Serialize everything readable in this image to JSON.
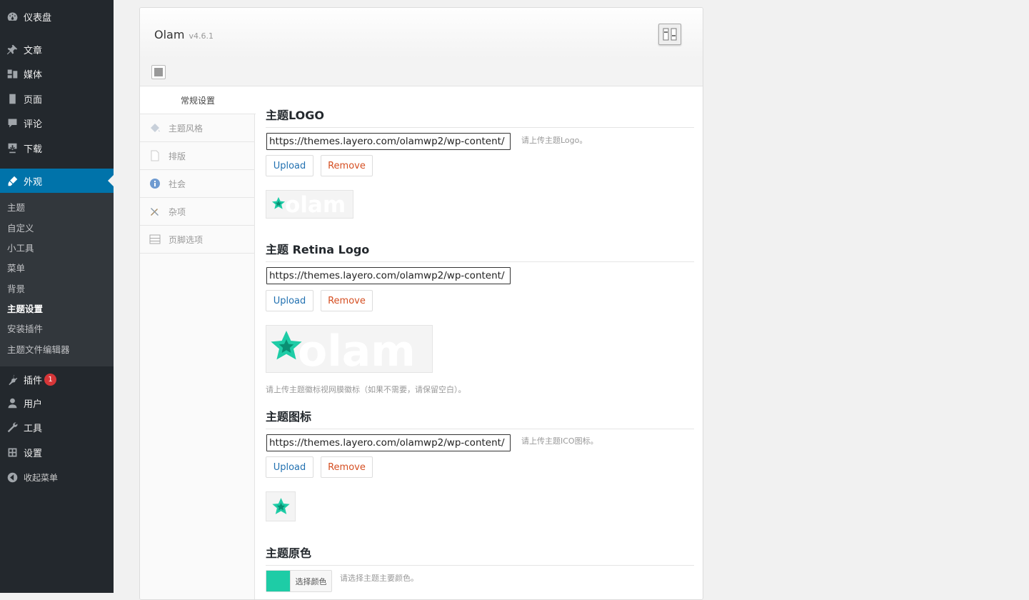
{
  "sidebar": {
    "menu": [
      {
        "label": "仪表盘",
        "icon": "dashboard-icon"
      },
      {
        "label": "文章",
        "icon": "pin-icon"
      },
      {
        "label": "媒体",
        "icon": "media-icon"
      },
      {
        "label": "页面",
        "icon": "page-icon"
      },
      {
        "label": "评论",
        "icon": "comment-icon"
      },
      {
        "label": "下载",
        "icon": "download-icon"
      },
      {
        "label": "外观",
        "icon": "appearance-icon"
      },
      {
        "label": "插件",
        "icon": "plugin-icon",
        "badge": "1"
      },
      {
        "label": "用户",
        "icon": "user-icon"
      },
      {
        "label": "工具",
        "icon": "wrench-icon"
      },
      {
        "label": "设置",
        "icon": "settings-icon"
      },
      {
        "label": "收起菜单",
        "icon": "collapse-icon"
      }
    ],
    "submenu": [
      "主题",
      "自定义",
      "小工具",
      "菜单",
      "背景",
      "主题设置",
      "安装插件",
      "主题文件编辑器"
    ],
    "active_submenu": "主题设置",
    "colors": {
      "bg": "#23282d",
      "current": "#0073aa",
      "badge": "#d63638"
    }
  },
  "panel": {
    "theme_name": "Olam",
    "theme_version": "v4.6.1",
    "tabs": [
      {
        "label": "常规设置",
        "icon": ""
      },
      {
        "label": "主题风格",
        "icon": "paint-bucket-icon"
      },
      {
        "label": "排版",
        "icon": "document-icon"
      },
      {
        "label": "社会",
        "icon": "info-icon"
      },
      {
        "label": "杂项",
        "icon": "tools-icon"
      },
      {
        "label": "页脚选项",
        "icon": "footer-icon"
      }
    ],
    "sections": {
      "logo": {
        "title": "主题LOGO",
        "url": "https://themes.layero.com/olamwp2/wp-content/",
        "desc": "请上传主题Logo。",
        "preview_text": "olam"
      },
      "retina": {
        "title": "主题 Retina Logo",
        "url": "https://themes.layero.com/olamwp2/wp-content/",
        "desc": "请上传主题徽标视网膜徽标（如果不需要，请保留空白）。",
        "preview_text": "olam"
      },
      "favicon": {
        "title": "主题图标",
        "url": "https://themes.layero.com/olamwp2/wp-content/",
        "desc": "请上传主题ICO图标。"
      },
      "color": {
        "title": "主题原色",
        "button_label": "选择颜色",
        "desc": "请选择主题主要颜色。",
        "value": "#1ecca6"
      }
    },
    "buttons": {
      "upload": "Upload",
      "remove": "Remove"
    }
  }
}
